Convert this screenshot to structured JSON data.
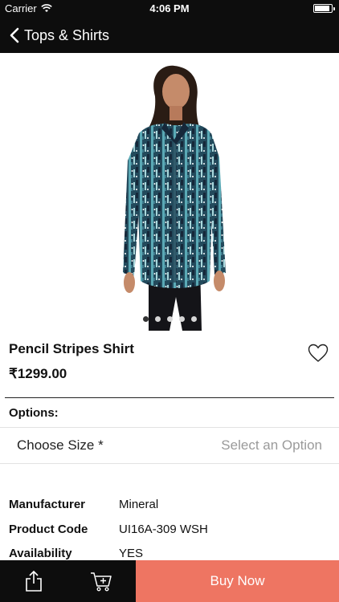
{
  "status_bar": {
    "carrier": "Carrier",
    "time": "4:06 PM",
    "battery_level": 0.9
  },
  "nav": {
    "title": "Tops & Shirts",
    "back_icon": "chevron-left-icon"
  },
  "gallery": {
    "image_count": 5,
    "active_index": 0
  },
  "product": {
    "name": "Pencil Stripes Shirt",
    "price": "₹1299.00"
  },
  "options": {
    "label": "Options:",
    "size_label": "Choose Size *",
    "size_value": "Select an Option"
  },
  "specs": [
    {
      "key": "Manufacturer",
      "value": "Mineral"
    },
    {
      "key": "Product Code",
      "value": "UI16A-309 WSH"
    },
    {
      "key": "Availability",
      "value": "YES"
    }
  ],
  "bottom_bar": {
    "share_icon": "share-icon",
    "cart_icon": "add-to-cart-icon",
    "buy_label": "Buy Now"
  },
  "colors": {
    "bar": "#0d0d0d",
    "accent": "#ee7562",
    "placeholder": "#9a9a9a"
  }
}
